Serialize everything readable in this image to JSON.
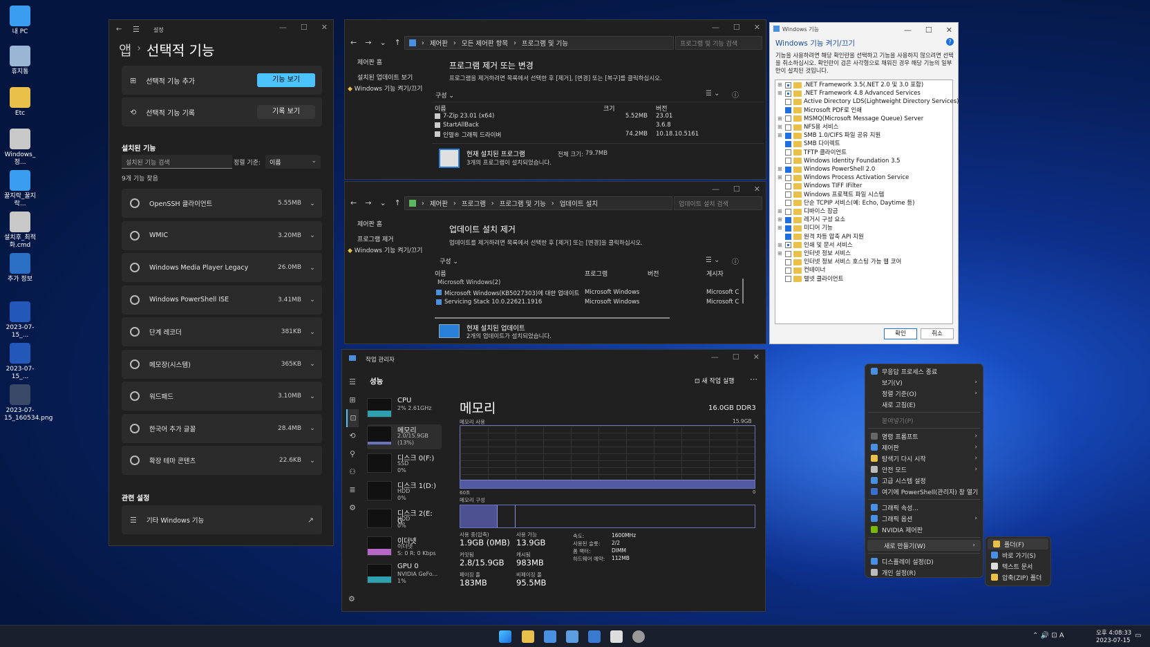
{
  "desktop": {
    "icons": [
      {
        "label": "내 PC",
        "color": "#3a9df0"
      },
      {
        "label": "휴지통",
        "color": "#9ab6d4"
      },
      {
        "label": "Etc",
        "color": "#e8c04a"
      },
      {
        "label": "Windows_정...",
        "color": "#c8c8c8"
      },
      {
        "label": "꿀지락_꿀지락...",
        "color": "#3a9df0"
      },
      {
        "label": "설치후_최적화.cmd",
        "color": "#c8c8c8"
      },
      {
        "label": "추가 정보",
        "color": "#2a6fc4"
      },
      {
        "label": "2023-07-15_...",
        "color": "#2458b8"
      },
      {
        "label": "2023-07-15_...",
        "color": "#2458b8"
      },
      {
        "label": "2023-07-15_160534.png",
        "color": "#3a4a66"
      }
    ]
  },
  "settings": {
    "titlebar": "설정",
    "breadcrumb_app": "앱",
    "breadcrumb_sep": "›",
    "title": "선택적 기능",
    "add_feature": "선택적 기능 추가",
    "view_features": "기능 보기",
    "history": "선택적 기능 기록",
    "view_history": "기록 보기",
    "installed_heading": "설치된 기능",
    "search_placeholder": "설치된 기능 검색",
    "sort_label": "정렬 기준:",
    "sort_value": "이름",
    "found": "9개 기능 찾음",
    "features": [
      {
        "name": "OpenSSH 클라이언트",
        "size": "5.55MB"
      },
      {
        "name": "WMIC",
        "size": "3.20MB"
      },
      {
        "name": "Windows Media Player Legacy",
        "size": "26.0MB"
      },
      {
        "name": "Windows PowerShell ISE",
        "size": "3.41MB"
      },
      {
        "name": "단계 레코더",
        "size": "381KB"
      },
      {
        "name": "메모장(시스템)",
        "size": "365KB"
      },
      {
        "name": "워드패드",
        "size": "3.10MB"
      },
      {
        "name": "한국어 추가 글꼴",
        "size": "28.4MB"
      },
      {
        "name": "확장 테마 콘텐츠",
        "size": "22.6KB"
      }
    ],
    "related_heading": "관련 설정",
    "other_windows": "기타 Windows 기능"
  },
  "programs": {
    "address": [
      "제어판",
      "모든 제어판 항목",
      "프로그램 및 기능"
    ],
    "search_placeholder": "프로그램 및 기능 검색",
    "nav_home": "제어판 홈",
    "nav_updates": "설치된 업데이트 보기",
    "nav_features": "Windows 기능 켜기/끄기",
    "heading": "프로그램 제거 또는 변경",
    "desc": "프로그램을 제거하려면 목록에서 선택한 후 [제거], [변경] 또는 [복구]를 클릭하십시오.",
    "organize": "구성 ⌄",
    "columns": [
      "이름",
      "크기",
      "버전"
    ],
    "rows": [
      {
        "name": "7-Zip 23.01 (x64)",
        "size": "5.52MB",
        "version": "23.01"
      },
      {
        "name": "StartAllBack",
        "size": "",
        "version": "3.6.8"
      },
      {
        "name": "인텔® 그래픽 드라이버",
        "size": "74.2MB",
        "version": "10.18.10.5161"
      }
    ],
    "footer_title": "현재 설치된 프로그램",
    "footer_total_label": "전체 크기:",
    "footer_total": "79.7MB",
    "footer_count": "3개의 프로그램이 설치되었습니다."
  },
  "updates": {
    "address": [
      "제어판",
      "프로그램",
      "프로그램 및 기능",
      "업데이트 설치"
    ],
    "search_placeholder": "업데이트 설치 검색",
    "nav_home": "제어판 홈",
    "nav_remove": "프로그램 제거",
    "nav_features": "Windows 기능 켜기/끄기",
    "heading": "업데이트 설치 제거",
    "desc": "업데이트를 제거하려면 목록에서 선택한 후 [제거] 또는 [변경]을 클릭하십시오.",
    "organize": "구성 ⌄",
    "columns": [
      "이름",
      "프로그램",
      "버전",
      "게시자"
    ],
    "group": "Microsoft Windows(2)",
    "rows": [
      {
        "name": "Microsoft Windows(KB5027303)에 대한 업데이트",
        "program": "Microsoft Windows",
        "publisher": "Microsoft C"
      },
      {
        "name": "Servicing Stack 10.0.22621.1916",
        "program": "Microsoft Windows",
        "publisher": "Microsoft C"
      }
    ],
    "footer_title": "현재 설치된 업데이트",
    "footer_count": "2개의 업데이트가 설치되었습니다."
  },
  "features": {
    "titlebar": "Windows 기능",
    "heading": "Windows 기능 켜기/끄기",
    "desc": "기능을 사용하려면 해당 확인란을 선택하고 기능을 사용하지 않으려면 선택을 취소하십시오. 확인란이 검은 사각형으로 채워진 경우 해당 기능의 일부만이 설치된 것입니다.",
    "items": [
      {
        "label": ".NET Framework 3.5(.NET 2.0 및 3.0 포함)",
        "state": "part",
        "exp": true
      },
      {
        "label": ".NET Framework 4.8 Advanced Services",
        "state": "part",
        "exp": true
      },
      {
        "label": "Active Directory LDS(Lightweight Directory Services)",
        "state": "off",
        "exp": false
      },
      {
        "label": "Microsoft PDF로 인쇄",
        "state": "on",
        "exp": false
      },
      {
        "label": "MSMQ(Microsoft Message Queue) Server",
        "state": "off",
        "exp": true
      },
      {
        "label": "NFS용 서비스",
        "state": "off",
        "exp": true
      },
      {
        "label": "SMB 1.0/CIFS 파일 공유 지원",
        "state": "on",
        "exp": true
      },
      {
        "label": "SMB 다이렉트",
        "state": "on",
        "exp": false
      },
      {
        "label": "TFTP 클라이언트",
        "state": "off",
        "exp": false
      },
      {
        "label": "Windows Identity Foundation 3.5",
        "state": "off",
        "exp": false
      },
      {
        "label": "Windows PowerShell 2.0",
        "state": "on",
        "exp": true
      },
      {
        "label": "Windows Process Activation Service",
        "state": "off",
        "exp": true
      },
      {
        "label": "Windows TIFF IFilter",
        "state": "off",
        "exp": false
      },
      {
        "label": "Windows 프로젝트 파일 시스템",
        "state": "off",
        "exp": false
      },
      {
        "label": "단순 TCPIP 서비스(예: Echo, Daytime 등)",
        "state": "off",
        "exp": false
      },
      {
        "label": "디바이스 잠금",
        "state": "off",
        "exp": true
      },
      {
        "label": "레거시 구성 요소",
        "state": "on",
        "exp": true
      },
      {
        "label": "미디어 기능",
        "state": "on",
        "exp": true
      },
      {
        "label": "원격 차등 압축 API 지원",
        "state": "on",
        "exp": false
      },
      {
        "label": "인쇄 및 문서 서비스",
        "state": "part",
        "exp": true
      },
      {
        "label": "인터넷 정보 서비스",
        "state": "off",
        "exp": true
      },
      {
        "label": "인터넷 정보 서비스 호스팅 가능 웹 코어",
        "state": "off",
        "exp": false
      },
      {
        "label": "컨테이너",
        "state": "off",
        "exp": false
      },
      {
        "label": "텔넷 클라이언트",
        "state": "off",
        "exp": false
      }
    ],
    "ok": "확인",
    "cancel": "취소"
  },
  "taskmgr": {
    "titlebar": "작업 관리자",
    "section": "성능",
    "new_task": "새 작업 실행",
    "more": "⋯",
    "resources": [
      {
        "title": "CPU",
        "sub1": "2% 2.61GHz",
        "sub2": "",
        "sub3": ""
      },
      {
        "title": "메모리",
        "sub1": "2.0/15.9GB (13%)",
        "sub2": "",
        "sub3": ""
      },
      {
        "title": "디스크 0(F:)",
        "sub1": "SSD",
        "sub2": "0%",
        "sub3": ""
      },
      {
        "title": "디스크 1(D:)",
        "sub1": "HDD",
        "sub2": "0%",
        "sub3": ""
      },
      {
        "title": "디스크 2(E: G:",
        "sub1": "HDD",
        "sub2": "0%",
        "sub3": ""
      },
      {
        "title": "이더넷",
        "sub1": "이더넷",
        "sub2": "S: 0 R: 0 Kbps",
        "sub3": ""
      },
      {
        "title": "GPU 0",
        "sub1": "NVIDIA GeFo...",
        "sub2": "1%",
        "sub3": ""
      }
    ],
    "mem_title": "메모리",
    "mem_total": "16.0GB DDR3",
    "usage_label": "메모리 사용",
    "usage_max": "15.9GB",
    "axis_left": "60초",
    "axis_right": "0",
    "composition_label": "메모리 구성",
    "stats": {
      "in_use_label": "사용 중(압축)",
      "in_use": "1.9GB (0MB)",
      "avail_label": "사용 가능",
      "avail": "13.9GB",
      "commit_label": "커밋됨",
      "commit": "2.8/15.9GB",
      "cached_label": "캐시됨",
      "cached": "983MB",
      "paged_label": "페이징 풀",
      "paged": "183MB",
      "nonpaged_label": "비페이징 풀",
      "nonpaged": "95.5MB",
      "speed_label": "속도:",
      "speed": "1600MHz",
      "slots_label": "사용된 슬롯:",
      "slots": "2/2",
      "form_label": "폼 팩터:",
      "form": "DIMM",
      "reserved_label": "하드웨어 예약:",
      "reserved": "112MB"
    }
  },
  "context_menu": {
    "items": [
      {
        "label": "무응답 프로세스 종료",
        "icon": "#4a90e2",
        "arrow": false,
        "dim": false
      },
      {
        "label": "보기(V)",
        "icon": "",
        "arrow": true,
        "dim": false
      },
      {
        "label": "정렬 기준(O)",
        "icon": "",
        "arrow": true,
        "dim": false
      },
      {
        "label": "새로 고침(E)",
        "icon": "",
        "arrow": false,
        "dim": false
      },
      {
        "label": "붙여넣기(P)",
        "icon": "",
        "arrow": false,
        "dim": true
      },
      {
        "label": "명령 프롬프트",
        "icon": "#666666",
        "arrow": true,
        "dim": false
      },
      {
        "label": "제어판",
        "icon": "#4a90e2",
        "arrow": true,
        "dim": false
      },
      {
        "label": "탐색기 다시 시작",
        "icon": "#e8c04a",
        "arrow": true,
        "dim": false
      },
      {
        "label": "안전 모드",
        "icon": "#bbbbbb",
        "arrow": true,
        "dim": false
      },
      {
        "label": "고급 시스템 설정",
        "icon": "#4a90e2",
        "arrow": false,
        "dim": false
      },
      {
        "label": "여기에 PowerShell(관리자) 창 열기",
        "icon": "#3a6fd0",
        "arrow": false,
        "dim": false
      },
      {
        "label": "그래픽 속성...",
        "icon": "#4a90e2",
        "arrow": false,
        "dim": false
      },
      {
        "label": "그래픽 옵션",
        "icon": "#4a90e2",
        "arrow": true,
        "dim": false
      },
      {
        "label": "NVIDIA 제어판",
        "icon": "#76b900",
        "arrow": false,
        "dim": false
      },
      {
        "label": "새로 만들기(W)",
        "icon": "",
        "arrow": true,
        "dim": false
      },
      {
        "label": "디스플레이 설정(D)",
        "icon": "#4a90e2",
        "arrow": false,
        "dim": false
      },
      {
        "label": "개인 설정(R)",
        "icon": "#bbbbbb",
        "arrow": false,
        "dim": false
      }
    ],
    "submenu": [
      {
        "label": "폴더(F)",
        "icon": "#e8c04a"
      },
      {
        "label": "바로 가기(S)",
        "icon": "#4a90e2"
      },
      {
        "label": "텍스트 문서",
        "icon": "#dddddd"
      },
      {
        "label": "압축(ZIP) 폴더",
        "icon": "#e8c04a"
      }
    ]
  },
  "taskbar": {
    "time": "오후 4:08:33",
    "date": "2023-07-15",
    "tray": "⌃  🔊  ⊡  A"
  }
}
